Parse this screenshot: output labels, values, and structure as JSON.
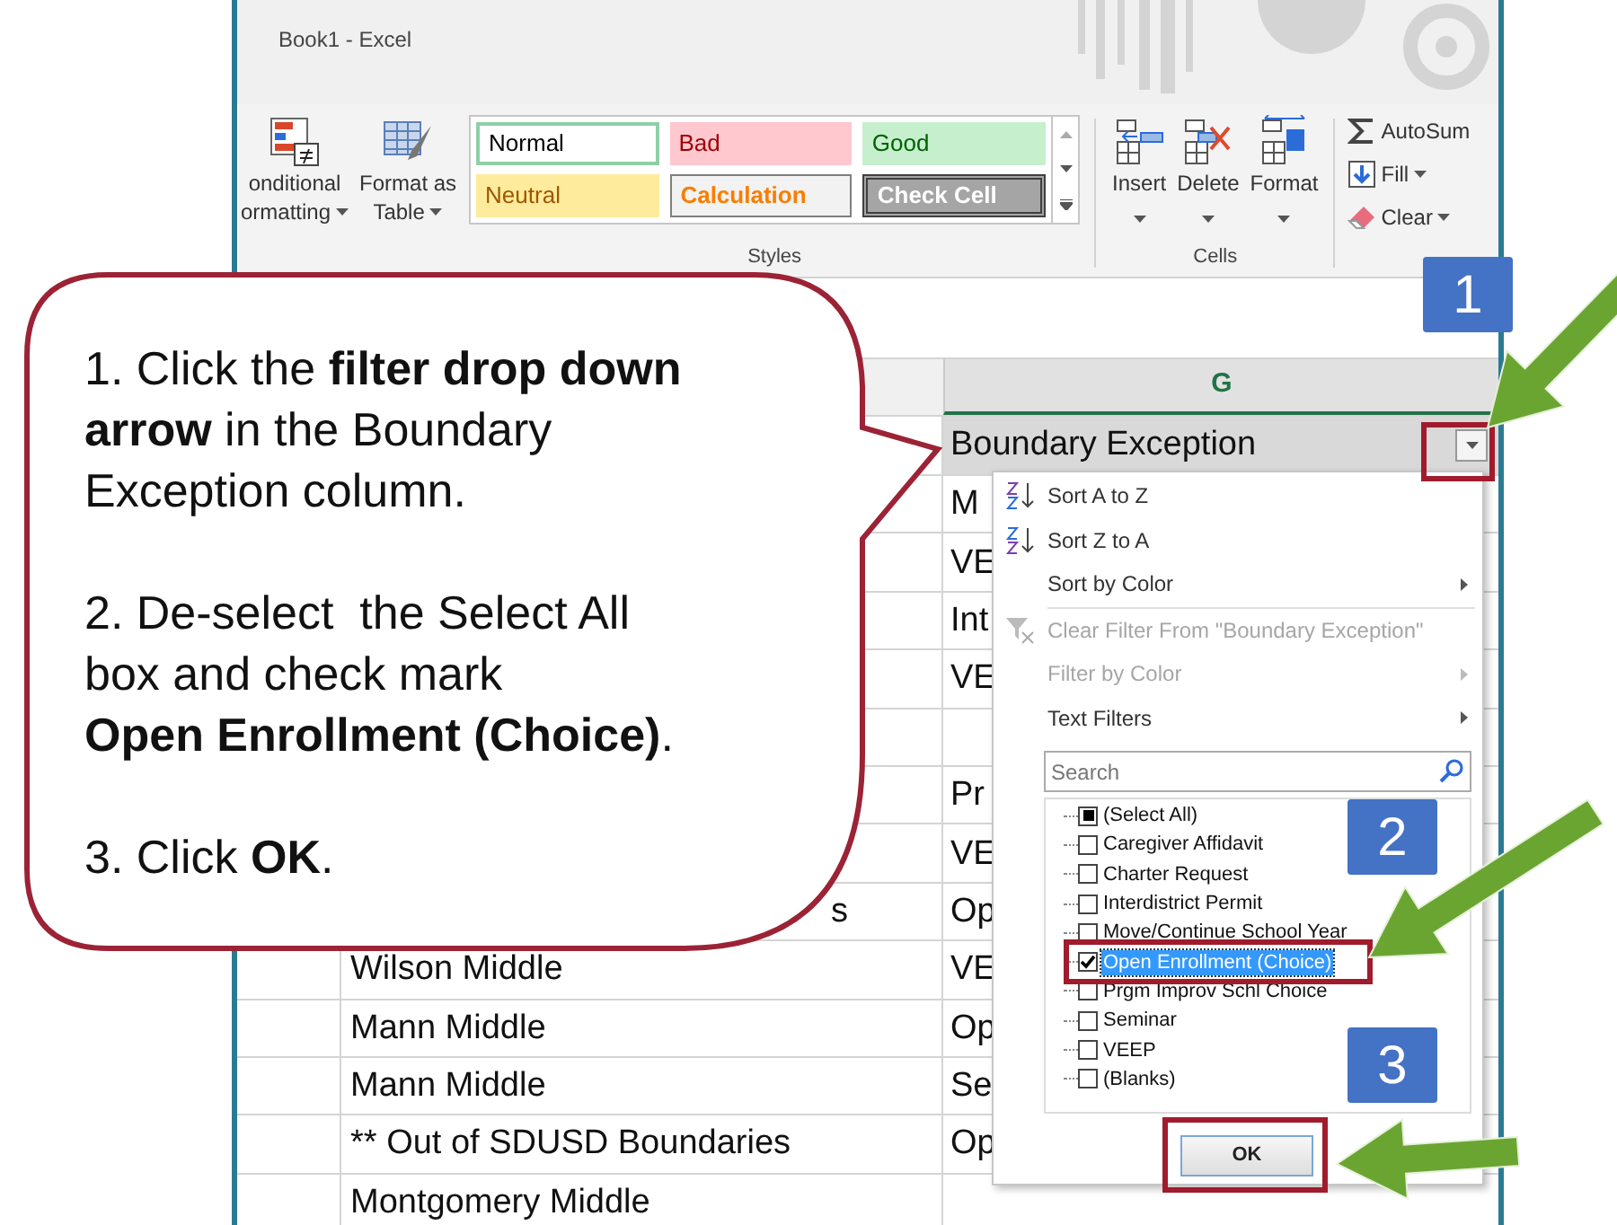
{
  "window": {
    "title": "Book1 - Excel"
  },
  "ribbon": {
    "format_buttons": [
      {
        "lines": [
          "onditional",
          "ormatting"
        ],
        "caret": true
      },
      {
        "lines": [
          "Format as",
          "Table"
        ],
        "caret": true
      }
    ],
    "styles": {
      "label": "Styles",
      "items": [
        {
          "name": "Normal",
          "kind": "normal"
        },
        {
          "name": "Bad",
          "kind": "bad"
        },
        {
          "name": "Good",
          "kind": "good"
        },
        {
          "name": "Neutral",
          "kind": "neutral"
        },
        {
          "name": "Calculation",
          "kind": "calculation"
        },
        {
          "name": "Check Cell",
          "kind": "check"
        }
      ]
    },
    "cells": {
      "label": "Cells",
      "buttons": [
        {
          "label": "Insert",
          "kind": "insert"
        },
        {
          "label": "Delete",
          "kind": "delete"
        },
        {
          "label": "Format",
          "kind": "format"
        }
      ]
    },
    "editing": [
      {
        "label": "AutoSum",
        "kind": "sum",
        "caret": false
      },
      {
        "label": "Fill",
        "kind": "fill",
        "caret": true
      },
      {
        "label": "Clear",
        "kind": "clear",
        "caret": true
      }
    ]
  },
  "sheet": {
    "column_header": "G",
    "header_cell": "Boundary Exception",
    "rows": [
      {
        "col_b": "",
        "col_g": "M"
      },
      {
        "col_b": "",
        "col_g": "VE"
      },
      {
        "col_b": "",
        "col_g": "Int"
      },
      {
        "col_b": "",
        "col_g": "VE"
      },
      {
        "col_b": "",
        "col_g": ""
      },
      {
        "col_b": "",
        "col_g": "Pr"
      },
      {
        "col_b": "",
        "col_g": "VE"
      },
      {
        "col_b": "s",
        "col_g": "Op",
        "clipped_left": true
      },
      {
        "col_b": "Wilson Middle",
        "col_g": "VE"
      },
      {
        "col_b": "Mann Middle",
        "col_g": "Op"
      },
      {
        "col_b": "Mann Middle",
        "col_g": "Se"
      },
      {
        "col_b": "** Out of SDUSD Boundaries",
        "col_g": "Op"
      },
      {
        "col_b": "Montgomery Middle",
        "col_g": ""
      }
    ]
  },
  "filter_menu": {
    "items": [
      {
        "label": "Sort A to Z",
        "kind": "sort-az",
        "disabled": false,
        "submenu": false
      },
      {
        "label": "Sort Z to A",
        "kind": "sort-za",
        "disabled": false,
        "submenu": false
      },
      {
        "label": "Sort by Color",
        "kind": "plain",
        "disabled": false,
        "submenu": true
      },
      {
        "label": "Clear Filter From \"Boundary Exception\"",
        "kind": "clear-filter",
        "disabled": true,
        "submenu": false
      },
      {
        "label": "Filter by Color",
        "kind": "plain",
        "disabled": true,
        "submenu": true
      },
      {
        "label": "Text Filters",
        "kind": "plain",
        "disabled": false,
        "submenu": true
      }
    ],
    "search": {
      "placeholder": "Search"
    },
    "values": [
      {
        "label": "(Select All)",
        "indeterminate": true,
        "selected": false
      },
      {
        "label": "Caregiver Affidavit",
        "checked": false,
        "selected": false
      },
      {
        "label": "Charter Request",
        "checked": false,
        "selected": false
      },
      {
        "label": "Interdistrict Permit",
        "checked": false,
        "selected": false
      },
      {
        "label": "Move/Continue School Year",
        "checked": false,
        "selected": false
      },
      {
        "label": "Open Enrollment (Choice)",
        "checked": true,
        "selected": true
      },
      {
        "label": "Prgm Improv Schl Choice",
        "checked": false,
        "selected": false
      },
      {
        "label": "Seminar",
        "checked": false,
        "selected": false
      },
      {
        "label": "VEEP",
        "checked": false,
        "selected": false
      },
      {
        "label": "(Blanks)",
        "checked": false,
        "selected": false
      }
    ],
    "ok": "OK"
  },
  "callout": {
    "steps": [
      {
        "lines": [
          "1. Click the **filter drop down**",
          "**arrow** in the Boundary",
          "Exception column."
        ]
      },
      {
        "lines": [
          "2. De-select  the Select All",
          "box and check mark",
          "**Open Enrollment (Choice)**."
        ]
      },
      {
        "lines": [
          "3. Click **OK**."
        ]
      }
    ]
  },
  "badges": [
    "1",
    "2",
    "3"
  ]
}
